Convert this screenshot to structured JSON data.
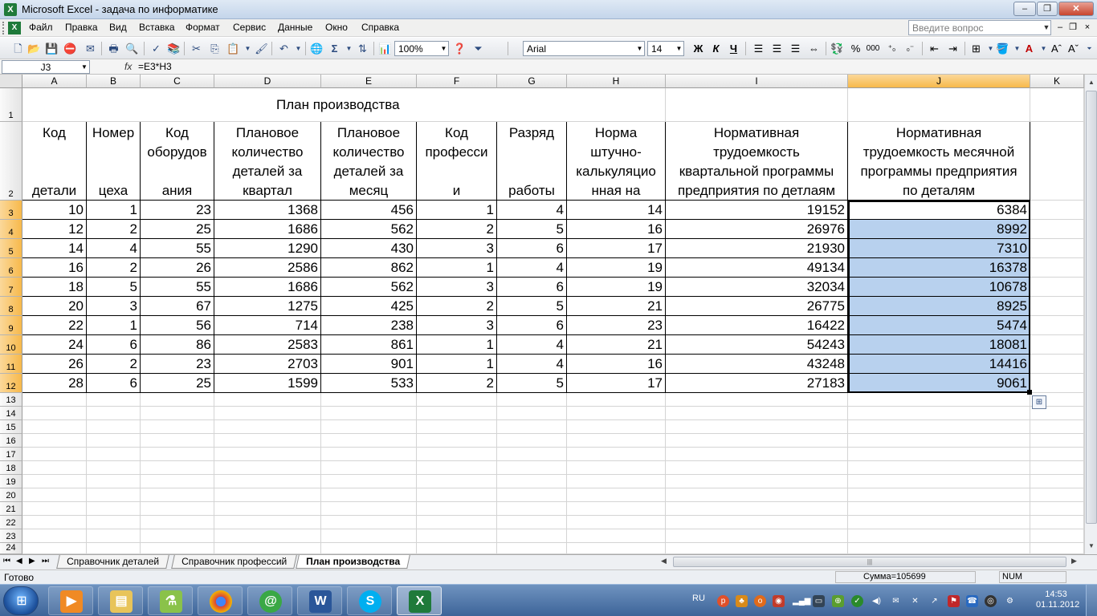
{
  "window": {
    "title": "Microsoft Excel - задача по информатике",
    "app_icon_glyph": "X",
    "btn_minimize": "–",
    "btn_restore": "❐",
    "btn_close": "✕"
  },
  "menubar": {
    "items": [
      "Файл",
      "Правка",
      "Вид",
      "Вставка",
      "Формат",
      "Сервис",
      "Данные",
      "Окно",
      "Справка"
    ],
    "help_placeholder": "Введите вопрос",
    "mdi_min": "–",
    "mdi_restore": "❐",
    "mdi_close": "×"
  },
  "toolbar": {
    "zoom": "100%",
    "font_name": "Arial",
    "font_size": "14",
    "bold_label": "Ж",
    "italic_label": "К",
    "underline_label": "Ч",
    "percent_label": "%",
    "thousands_label": "000",
    "autosum_label": "Σ"
  },
  "formula_bar": {
    "name_box": "J3",
    "fx_label": "fx",
    "formula": "=E3*H3"
  },
  "sheet": {
    "columns": [
      "A",
      "B",
      "C",
      "D",
      "E",
      "F",
      "G",
      "H",
      "I",
      "J",
      "K"
    ],
    "row_numbers": [
      "1",
      "2",
      "3",
      "4",
      "5",
      "6",
      "7",
      "8",
      "9",
      "10",
      "11",
      "12",
      "13",
      "14",
      "15",
      "16",
      "17",
      "18",
      "19",
      "20",
      "21",
      "22",
      "23",
      "24"
    ],
    "title": "План производства",
    "headers": [
      {
        "line1": "Код",
        "line2": "",
        "line3": "",
        "line4": "детали"
      },
      {
        "line1": "Номер",
        "line2": "",
        "line3": "",
        "line4": "цеха"
      },
      {
        "line1": "Код",
        "line2": "оборудов",
        "line3": "",
        "line4": "ания"
      },
      {
        "line1": "Плановое",
        "line2": "количество",
        "line3": "деталей за",
        "line4": "квартал"
      },
      {
        "line1": "Плановое",
        "line2": "количество",
        "line3": "деталей за",
        "line4": "месяц"
      },
      {
        "line1": "Код",
        "line2": "професси",
        "line3": "",
        "line4": "и"
      },
      {
        "line1": "Разряд",
        "line2": "",
        "line3": "",
        "line4": "работы"
      },
      {
        "line1": "Норма",
        "line2": "штучно-",
        "line3": "калькуляцио",
        "line4": "нная на"
      },
      {
        "line1": "Нормативная",
        "line2": "трудоемкость",
        "line3": "квартальной программы",
        "line4": "предприятия по детлаям"
      },
      {
        "line1": "Нормативная",
        "line2": "трудоемкость месячной",
        "line3": "программы предприятия",
        "line4": "по деталям"
      }
    ],
    "rows": [
      [
        "10",
        "1",
        "23",
        "1368",
        "456",
        "1",
        "4",
        "14",
        "19152",
        "6384"
      ],
      [
        "12",
        "2",
        "25",
        "1686",
        "562",
        "2",
        "5",
        "16",
        "26976",
        "8992"
      ],
      [
        "14",
        "4",
        "55",
        "1290",
        "430",
        "3",
        "6",
        "17",
        "21930",
        "7310"
      ],
      [
        "16",
        "2",
        "26",
        "2586",
        "862",
        "1",
        "4",
        "19",
        "49134",
        "16378"
      ],
      [
        "18",
        "5",
        "55",
        "1686",
        "562",
        "3",
        "6",
        "19",
        "32034",
        "10678"
      ],
      [
        "20",
        "3",
        "67",
        "1275",
        "425",
        "2",
        "5",
        "21",
        "26775",
        "8925"
      ],
      [
        "22",
        "1",
        "56",
        "714",
        "238",
        "3",
        "6",
        "23",
        "16422",
        "5474"
      ],
      [
        "24",
        "6",
        "86",
        "2583",
        "861",
        "1",
        "4",
        "21",
        "54243",
        "18081"
      ],
      [
        "26",
        "2",
        "23",
        "2703",
        "901",
        "1",
        "4",
        "16",
        "43248",
        "14416"
      ],
      [
        "28",
        "6",
        "25",
        "1599",
        "533",
        "2",
        "5",
        "17",
        "27183",
        "9061"
      ]
    ],
    "tabs": [
      "Справочник деталей",
      "Справочник профессий",
      "План производства"
    ],
    "active_tab": "План производства"
  },
  "status": {
    "ready": "Готово",
    "sum": "Сумма=105699",
    "num": "NUM"
  },
  "taskbar": {
    "lang": "RU",
    "time": "14:53",
    "date": "01.11.2012",
    "apps": [
      "media-player",
      "file-explorer",
      "network-tool",
      "chrome",
      "icq",
      "word",
      "skype",
      "excel"
    ]
  },
  "colors": {
    "selection": "#b8d1ee",
    "active_header": "#f7b94b",
    "taskbar": "#3d6498"
  }
}
